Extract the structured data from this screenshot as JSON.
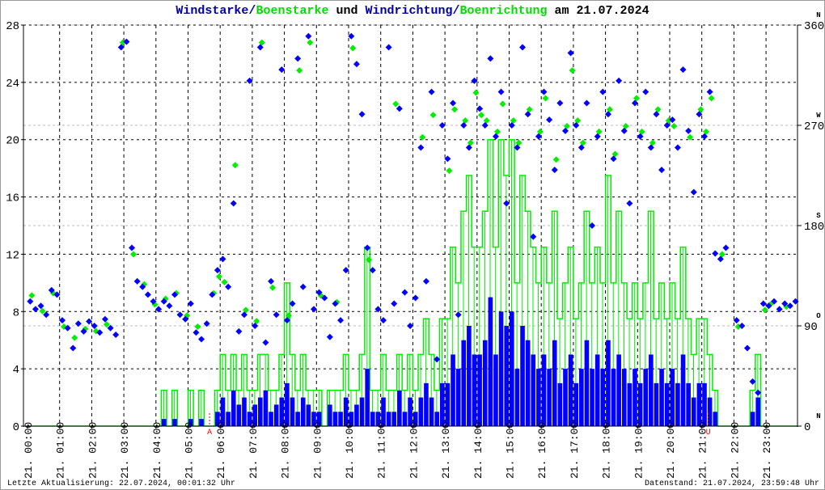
{
  "title": {
    "part1": "Windstarke",
    "sep1": "/",
    "part2": "Boenstarke",
    "mid": " und ",
    "part3": "Windrichtung",
    "sep2": "/",
    "part4": "Boenrichtung",
    "end": " am 21.07.2024"
  },
  "footer": {
    "left": "Letzte Aktualisierung: 22.07.2024, 00:01:32 Uhr",
    "right": "Datenstand: 21.07.2024, 23:59:48 Uhr"
  },
  "colors": {
    "speed": "#0000ff",
    "gust": "#00ee00",
    "direction": "#0000ff",
    "gust_direction": "#00ee00",
    "marker": "#ff0000"
  },
  "chart_data": {
    "type": "line",
    "title": "Windstarke/Boenstarke und Windrichtung/Boenrichtung am 21.07.2024",
    "xlabel": "",
    "ylabel": "",
    "xlim": [
      0,
      24
    ],
    "ylim": [
      0,
      28
    ],
    "y2lim": [
      0,
      360
    ],
    "yticks": [
      "0",
      "4",
      "8",
      "12",
      "16",
      "20",
      "24",
      "28"
    ],
    "y2ticks": [
      {
        "v": 0,
        "label": "0",
        "dir": "N"
      },
      {
        "v": 90,
        "label": "90",
        "dir": "O"
      },
      {
        "v": 180,
        "label": "180",
        "dir": "S"
      },
      {
        "v": 270,
        "label": "270",
        "dir": "W"
      },
      {
        "v": 360,
        "label": "360",
        "dir": "N"
      }
    ],
    "xticks": [
      "21. 00:00",
      "21. 01:00",
      "21. 02:00",
      "21. 03:00",
      "21. 04:00",
      "21. 05:00",
      "21. 06:00",
      "21. 07:00",
      "21. 08:00",
      "21. 09:00",
      "21. 10:00",
      "21. 11:00",
      "21. 12:00",
      "21. 13:00",
      "21. 14:00",
      "21. 15:00",
      "21. 16:00",
      "21. 17:00",
      "21. 18:00",
      "21. 19:00",
      "21. 20:00",
      "21. 21:00",
      "21. 22:00",
      "21. 23:00"
    ],
    "markers": [
      {
        "label": "A",
        "hour": 5.67
      },
      {
        "label": "U",
        "hour": 21.2
      }
    ],
    "step_minutes": 10,
    "series": [
      {
        "name": "Windstarke",
        "values": [
          0,
          0,
          0,
          0,
          0,
          0,
          0,
          0,
          0,
          0,
          0,
          0,
          0,
          0,
          0,
          0,
          0,
          0,
          0,
          0,
          0,
          0,
          0,
          0,
          0,
          0.5,
          0,
          0.5,
          0,
          0,
          0.5,
          0,
          0.5,
          0,
          0,
          1,
          2,
          1,
          2.5,
          1.5,
          2,
          1,
          1.5,
          2,
          2.5,
          1,
          1.5,
          2,
          3,
          2,
          1,
          2,
          1.5,
          1,
          1,
          0,
          1.5,
          1,
          1,
          2,
          1,
          1.5,
          2,
          4,
          1,
          1,
          2,
          1,
          1,
          2.5,
          1,
          2,
          1,
          2,
          3,
          2,
          1,
          3,
          3,
          5,
          4,
          6,
          7,
          5,
          5,
          6,
          9,
          5,
          8,
          7,
          8,
          4,
          7,
          6,
          5,
          4,
          5,
          4,
          6,
          3,
          4,
          5,
          3,
          4,
          6,
          4,
          5,
          4,
          6,
          4,
          5,
          4,
          3,
          4,
          3,
          4,
          5,
          3,
          4,
          3,
          4,
          3,
          5,
          3,
          2,
          3,
          3,
          2,
          1,
          0,
          0,
          0,
          0,
          0,
          0,
          1,
          2,
          0,
          0,
          0,
          0,
          0,
          0,
          0
        ]
      },
      {
        "name": "Boenstarke",
        "values": [
          0,
          0,
          0,
          0,
          0,
          0,
          0,
          0,
          0,
          0,
          0,
          0,
          0,
          0,
          0,
          0,
          0,
          0,
          0,
          0,
          0,
          0,
          0,
          0,
          0,
          2.5,
          0,
          2.5,
          0,
          0,
          2.5,
          0,
          2.5,
          0,
          0,
          2.5,
          5,
          2.5,
          5,
          2.5,
          5,
          2.5,
          2.5,
          5,
          5,
          2.5,
          2.5,
          5,
          10,
          5,
          2.5,
          5,
          2.5,
          2.5,
          2.5,
          0,
          2.5,
          2.5,
          2.5,
          5,
          2.5,
          2.5,
          5,
          12.5,
          2.5,
          2.5,
          5,
          2.5,
          2.5,
          5,
          2.5,
          5,
          2.5,
          5,
          7.5,
          5,
          2.5,
          7.5,
          7.5,
          12.5,
          10,
          15,
          17.5,
          12.5,
          12.5,
          15,
          20,
          12.5,
          20,
          17.5,
          20,
          10,
          17.5,
          15,
          12.5,
          10,
          12.5,
          10,
          15,
          7.5,
          10,
          12.5,
          7.5,
          10,
          15,
          10,
          12.5,
          10,
          17.5,
          10,
          15,
          10,
          7.5,
          10,
          7.5,
          10,
          15,
          7.5,
          10,
          7.5,
          10,
          7.5,
          12.5,
          7.5,
          5,
          7.5,
          7.5,
          5,
          2.5,
          0,
          0,
          0,
          0,
          0,
          0,
          2.5,
          5,
          0,
          0,
          0,
          0,
          0,
          0,
          0
        ]
      },
      {
        "name": "Windrichtung",
        "unit": "deg",
        "values": [
          112,
          105,
          108,
          100,
          122,
          118,
          95,
          88,
          70,
          92,
          85,
          94,
          90,
          84,
          96,
          88,
          82,
          340,
          345,
          160,
          130,
          125,
          118,
          112,
          105,
          112,
          108,
          118,
          100,
          96,
          110,
          84,
          78,
          92,
          118,
          140,
          150,
          125,
          200,
          85,
          100,
          310,
          90,
          340,
          75,
          130,
          100,
          320,
          95,
          110,
          330,
          125,
          350,
          105,
          120,
          115,
          80,
          110,
          95,
          140,
          350,
          325,
          280,
          160,
          140,
          105,
          95,
          340,
          110,
          285,
          120,
          90,
          115,
          250,
          130,
          300,
          60,
          270,
          240,
          290,
          100,
          270,
          250,
          310,
          285,
          270,
          330,
          260,
          300,
          200,
          270,
          250,
          340,
          280,
          170,
          260,
          300,
          275,
          230,
          290,
          265,
          335,
          270,
          250,
          290,
          180,
          260,
          300,
          280,
          240,
          310,
          265,
          200,
          290,
          260,
          300,
          250,
          280,
          230,
          270,
          275,
          250,
          320,
          265,
          210,
          280,
          260,
          300,
          155,
          150,
          160,
          null,
          95,
          90,
          70,
          40,
          30,
          110,
          108,
          112,
          105,
          110,
          108,
          112
        ]
      },
      {
        "name": "Boenrichtung",
        "unit": "deg",
        "values": [
          118,
          null,
          104,
          null,
          120,
          null,
          90,
          null,
          80,
          null,
          88,
          null,
          86,
          null,
          92,
          null,
          null,
          345,
          null,
          155,
          null,
          128,
          null,
          110,
          null,
          115,
          null,
          120,
          null,
          100,
          null,
          90,
          null,
          null,
          120,
          135,
          130,
          null,
          235,
          null,
          105,
          null,
          95,
          345,
          null,
          125,
          null,
          null,
          100,
          null,
          320,
          null,
          345,
          null,
          118,
          null,
          null,
          112,
          null,
          null,
          340,
          null,
          null,
          150,
          null,
          null,
          null,
          null,
          290,
          null,
          null,
          null,
          null,
          260,
          null,
          280,
          null,
          null,
          230,
          285,
          null,
          275,
          255,
          300,
          280,
          275,
          null,
          265,
          290,
          null,
          275,
          255,
          null,
          285,
          null,
          265,
          295,
          null,
          240,
          null,
          270,
          320,
          275,
          255,
          null,
          null,
          265,
          null,
          285,
          245,
          null,
          270,
          null,
          295,
          265,
          null,
          255,
          285,
          null,
          275,
          270,
          null,
          null,
          260,
          null,
          285,
          265,
          295,
          null,
          155,
          null,
          null,
          90,
          null,
          null,
          null,
          null,
          105,
          110,
          null,
          null,
          108,
          null,
          null
        ]
      }
    ]
  }
}
